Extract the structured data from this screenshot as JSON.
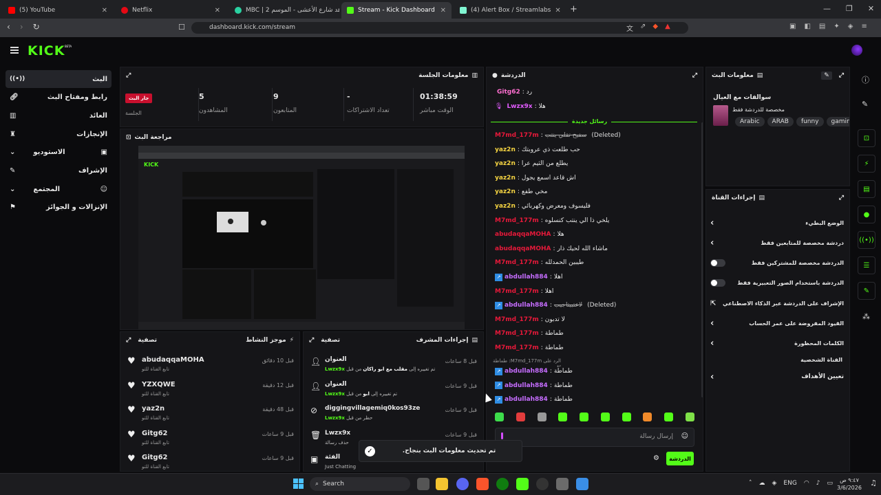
{
  "browser": {
    "tabs": [
      {
        "title": "(5) YouTube",
        "color": "#ff0000"
      },
      {
        "title": "Netflix",
        "color": "#e50914"
      },
      {
        "title": "MBC | شاهد شارع الأعشى - الموسم 2",
        "color": "#2ad1a1"
      },
      {
        "title": "Stream - Kick Dashboard",
        "color": "#53fc18"
      },
      {
        "title": "(4) Alert Box / Streamlabs",
        "color": "#80f5d2"
      }
    ],
    "new_tab_label": "+",
    "url": "dashboard.kick.com/stream"
  },
  "kick": {
    "logo": "KICK",
    "beta": "BETA",
    "accent": "#53fc18"
  },
  "sidebar": {
    "items": [
      {
        "label": "البث",
        "icon": "live-icon",
        "active": true
      },
      {
        "label": "رابط ومفتاح البث",
        "icon": "link-icon"
      },
      {
        "label": "العائد",
        "icon": "bank-icon"
      },
      {
        "label": "الإنجازات",
        "icon": "trophy-icon"
      },
      {
        "label": "الاستوديو",
        "icon": "chevron-down-icon"
      },
      {
        "label": "الإشراف",
        "icon": "wrench-icon"
      },
      {
        "label": "المجتمع",
        "icon": "chevron-down-icon"
      },
      {
        "label": "الإنزالات و الجوائز",
        "icon": "gift-icon"
      }
    ]
  },
  "session": {
    "title": "معلومات الجلسة",
    "live_badge": "جار البث",
    "session_label": "الجلسة",
    "stats": [
      {
        "value": "01:38:59",
        "label": "الوقت مباشر"
      },
      {
        "value": "-",
        "label": "تعداد الاشتراكات"
      },
      {
        "value": "9",
        "label": "المتابعون"
      },
      {
        "value": "5",
        "label": "المشاهدون"
      }
    ]
  },
  "preview": {
    "title": "مراجعة البث"
  },
  "activity": {
    "title": "موجز النشاط",
    "filter": "تصفية",
    "items": [
      {
        "user": "abudaqqaMOHA",
        "sub": "تابع القناة للتو",
        "time": "قبل 10 دقائق"
      },
      {
        "user": "YZXQWE",
        "sub": "تابع القناة للتو",
        "time": "قبل 12 دقيقة"
      },
      {
        "user": "yaz2n",
        "sub": "تابع القناة للتو",
        "time": "قبل 48 دقيقة"
      },
      {
        "user": "Gitg62",
        "sub": "تابع القناة للتو",
        "time": "قبل 9 ساعات"
      },
      {
        "user": "Gitg62",
        "sub": "تابع القناة للتو",
        "time": "قبل 9 ساعات"
      }
    ]
  },
  "modactions": {
    "title": "إجراءات المشرف",
    "filter": "تصفية",
    "items": [
      {
        "title": "العنوان",
        "sub_prefix": "تم تغييره إلى ",
        "sub_bold": "مقلب مع ابو راكان",
        "sub_suffix": " من قبل ",
        "by": "Lwzx9x",
        "time": "قبل 8 ساعات"
      },
      {
        "title": "العنوان",
        "sub_prefix": "تم تغييره إلى ",
        "sub_bold": "ابو",
        "sub_suffix": " من قبل ",
        "by": "Lwzx9x",
        "time": "قبل 9 ساعات"
      },
      {
        "title": "diggingvillagemiq0kos93ze",
        "sub_prefix": "حظر من قبل ",
        "sub_bold": "",
        "sub_suffix": "",
        "by": "Lwzx9x",
        "time": "قبل 9 ساعات"
      },
      {
        "title": "Lwzx9x",
        "sub_prefix": "حذف رسالة",
        "sub_bold": "",
        "sub_suffix": "",
        "by": "",
        "time": "قبل 9 ساعات"
      },
      {
        "title": "الفئة",
        "sub_prefix": "Just Chatting ",
        "sub_bold": "",
        "sub_suffix": "",
        "by": "",
        "time": "قبل 9 ساعات"
      }
    ]
  },
  "chat": {
    "title": "الدردشة",
    "new_messages": "رسائل جديدة",
    "pinned": [
      {
        "user": "Gitg62",
        "text": "رد",
        "color": "#ff6fd0"
      },
      {
        "user": "Lwzx9x",
        "text": "هلا",
        "color": "#e25cff"
      }
    ],
    "messages": [
      {
        "user": "M7md_177m",
        "text": "سفيح تقلي ينتب",
        "note": "(Deleted)",
        "color": "#e7193a"
      },
      {
        "user": "yaz2n",
        "text": "حب طلعت ذي عروبتك",
        "color": "#f5d442"
      },
      {
        "user": "yaz2n",
        "text": "يطلع من الثيم عرا",
        "color": "#f5d442"
      },
      {
        "user": "yaz2n",
        "text": "اش قاعد اسمع يجول",
        "color": "#f5d442"
      },
      {
        "user": "yaz2n",
        "text": "مخي طفع",
        "color": "#f5d442"
      },
      {
        "user": "yaz2n",
        "text": "فليسوف ومعرض وكهربائي",
        "color": "#f5d442"
      },
      {
        "user": "M7md_177m",
        "text": "يلخي ذا الي ينتب كنسلوه",
        "color": "#e7193a"
      },
      {
        "user": "abudaqqaMOHA",
        "text": "هلا",
        "color": "#e7193a"
      },
      {
        "user": "abudaqqaMOHA",
        "text": "ماشاء الله لحيك ذار",
        "color": "#e7193a"
      },
      {
        "user": "M7md_177m",
        "text": "طيبين الحمدلله",
        "color": "#e7193a"
      },
      {
        "user": "abdullah884",
        "text": "اهلا",
        "color": "#c66dff",
        "badge": true
      },
      {
        "user": "M7md_177m",
        "text": "اهلا",
        "color": "#e7193a"
      },
      {
        "user": "abdullah884",
        "text": "لاعتبيتاجيب",
        "note": "(Deleted)",
        "color": "#c66dff",
        "badge": true
      },
      {
        "user": "M7md_177m",
        "text": "لا تدبون",
        "color": "#e7193a"
      },
      {
        "user": "M7md_177m",
        "text": "طماطة",
        "color": "#e7193a"
      },
      {
        "user": "M7md_177m",
        "text": "طماطة",
        "color": "#e7193a"
      }
    ],
    "reply_hint": "الرد على M7md_177m: طماطة",
    "replies": [
      {
        "user": "abdullah884",
        "text": "طماطة",
        "color": "#c66dff",
        "badge": true
      },
      {
        "user": "abdullah884",
        "text": "طماطة",
        "color": "#c66dff",
        "badge": true
      },
      {
        "user": "abdullah884",
        "text": "طماطة",
        "color": "#c66dff",
        "badge": true
      }
    ],
    "input_placeholder": "إرسال رسالة",
    "send_label": "الدردشة",
    "toast": "تم تحديث معلومات البث بنجاح."
  },
  "streaminfo": {
    "title": "معلومات البث",
    "stream_title": "سوالفات مع العيال",
    "category": "مخصصة للدردشة فقط",
    "tags": [
      "Arabic",
      "ARAB",
      "funny",
      "gaming"
    ]
  },
  "channelactions": {
    "title": "إجراءات القناة",
    "items": [
      {
        "label": "الوضع البطيء",
        "kind": "chevron"
      },
      {
        "label": "دردشة مخصصة للمتابعين فقط",
        "kind": "chevron"
      },
      {
        "label": "الدردشة مخصصة للمشتركين فقط",
        "kind": "toggle"
      },
      {
        "label": "الدردشة باستخدام الصور التعبيرية فقط",
        "kind": "toggle"
      },
      {
        "label": "الإشراف على الدردشة عبر الذكاء الاصطناعي",
        "kind": "external"
      },
      {
        "label": "القيود المفروضة على عمر الحساب",
        "kind": "chevron"
      },
      {
        "label": "الكلمات المحظورة",
        "kind": "chevron"
      }
    ],
    "section_label": "القناة الشخصية",
    "goals_label": "تعيين الأهداف"
  },
  "taskbar": {
    "search_label": "Search",
    "lang": "ENG",
    "time": "٩:٤٧ ص",
    "date": "3/6/2026"
  }
}
